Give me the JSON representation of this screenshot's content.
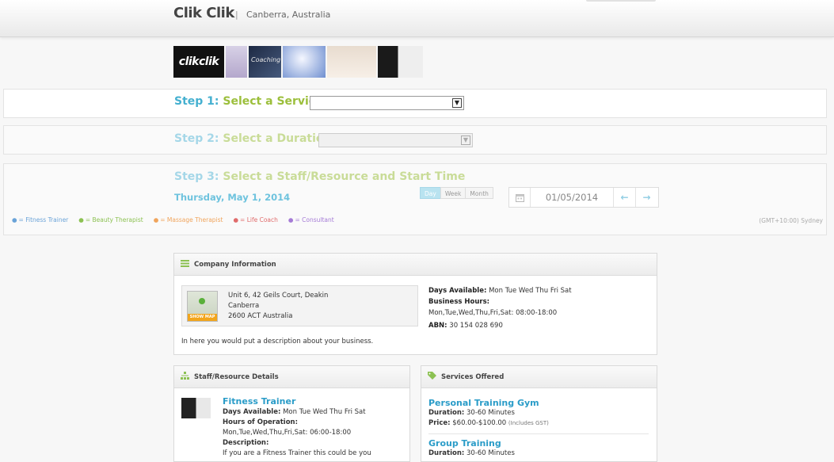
{
  "header": {
    "brand": "Clik Clik",
    "separator": "|",
    "location": "Canberra, Australia"
  },
  "gallery": {
    "logo_text": "clikclik",
    "thumb_text": "Coaching"
  },
  "step1": {
    "num": "Step 1:",
    "label": "Select a Service",
    "selected": ""
  },
  "step2": {
    "num": "Step 2:",
    "label": "Select a Duration",
    "selected": ""
  },
  "step3": {
    "num": "Step 3:",
    "label": "Select a Staff/Resource and Start Time",
    "date_heading": "Thursday, May 1, 2014",
    "view_tabs": [
      "Day",
      "Week",
      "Month"
    ],
    "active_view": "Day",
    "date_value": "01/05/2014",
    "legend": [
      {
        "label": "= Fitness Trainer",
        "color": "#6aa3d8"
      },
      {
        "label": "= Beauty Therapist",
        "color": "#8cc152"
      },
      {
        "label": "= Massage Therapist",
        "color": "#f0a45c"
      },
      {
        "label": "= Life Coach",
        "color": "#e06b6b"
      },
      {
        "label": "= Consultant",
        "color": "#a57bd6"
      }
    ],
    "timezone": "(GMT+10:00) Sydney"
  },
  "company": {
    "title": "Company Information",
    "address_lines": [
      "Unit 6, 42 Geils Court, Deakin",
      "Canberra",
      "2600 ACT Australia"
    ],
    "show_map": "SHOW MAP",
    "days_label": "Days Available:",
    "days": "Mon Tue Wed Thu Fri Sat",
    "hours_label": "Business Hours:",
    "hours": "Mon,Tue,Wed,Thu,Fri,Sat: 08:00-18:00",
    "abn_label": "ABN:",
    "abn": "30 154 028 690",
    "description": "In here you would put a description about your business."
  },
  "staff": {
    "title": "Staff/Resource Details",
    "name": "Fitness Trainer",
    "days_label": "Days Available:",
    "days": "Mon Tue Wed Thu Fri Sat",
    "hours_label": "Hours of Operation:",
    "hours": "Mon,Tue,Wed,Thu,Fri,Sat: 06:00-18:00",
    "desc_label": "Description:",
    "desc": "If you are a Fitness Trainer this could be you"
  },
  "services": {
    "title": "Services Offered",
    "items": [
      {
        "name": "Personal Training Gym",
        "duration_label": "Duration:",
        "duration": "30-60 Minutes",
        "price_label": "Price:",
        "price": "$60.00-$100.00",
        "gst": "(Includes GST)"
      },
      {
        "name": "Group Training",
        "duration_label": "Duration:",
        "duration": "30-60 Minutes"
      }
    ]
  },
  "colors": {
    "step_num": "#45b0d0",
    "step_label": "#9cbf3c",
    "link": "#2a9cc8"
  }
}
